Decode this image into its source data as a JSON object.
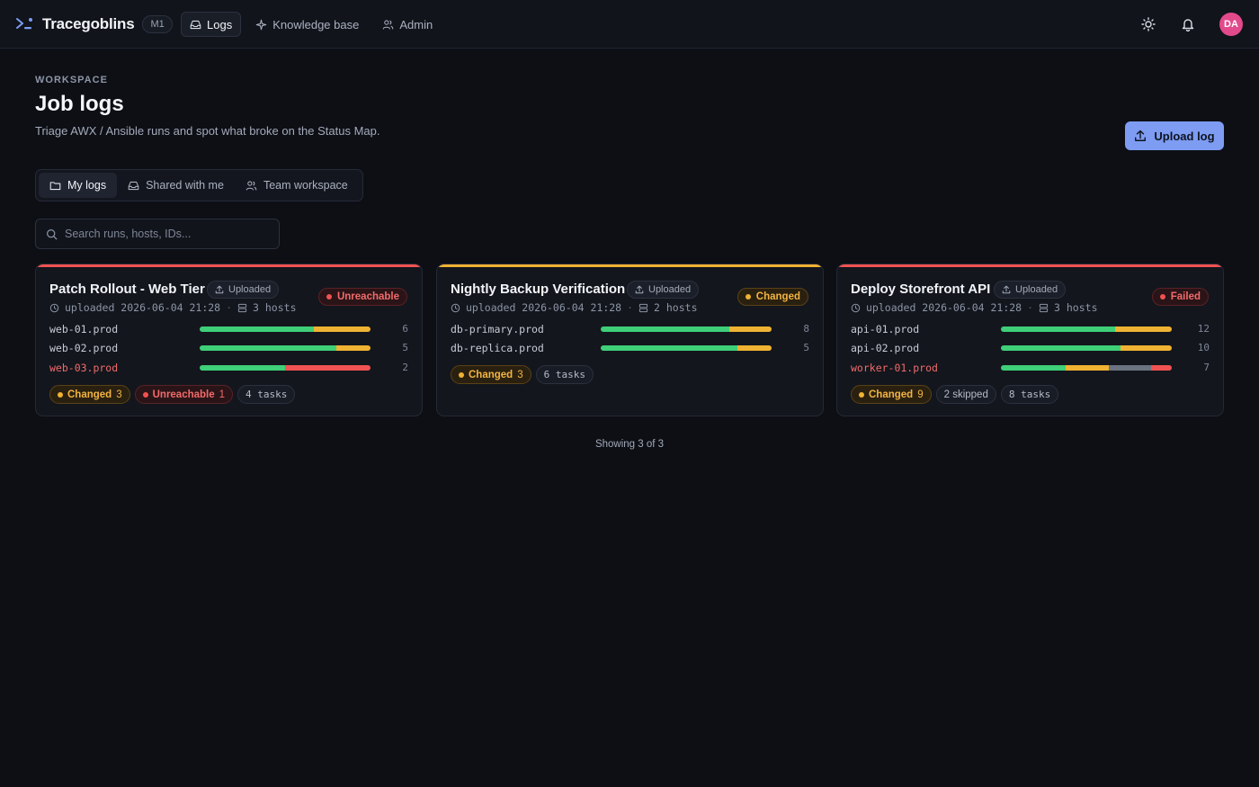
{
  "app": {
    "name": "Tracegoblins",
    "badge": "M1"
  },
  "nav": [
    {
      "label": "Logs",
      "icon": "inbox-icon",
      "active": true
    },
    {
      "label": "Knowledge base",
      "icon": "sparkle-icon",
      "active": false
    },
    {
      "label": "Admin",
      "icon": "users-icon",
      "active": false
    }
  ],
  "user": {
    "initials": "DA"
  },
  "header": {
    "eyebrow": "WORKSPACE",
    "title": "Job logs",
    "subtitle": "Triage AWX / Ansible runs and spot what broke on the Status Map.",
    "upload_label": "Upload log"
  },
  "tabs": [
    {
      "label": "My logs",
      "icon": "folder-icon",
      "active": true
    },
    {
      "label": "Shared with me",
      "icon": "inbox-icon",
      "active": false
    },
    {
      "label": "Team workspace",
      "icon": "users-icon",
      "active": false
    }
  ],
  "search": {
    "placeholder": "Search runs, hosts, IDs..."
  },
  "colors": {
    "ok": "#3ecf78",
    "changed": "#f0b232",
    "unreachable": "#f05252",
    "skipped": "#6b7280",
    "failed": "#f05252",
    "accent": "#7d9cf2"
  },
  "cards": [
    {
      "title": "Patch Rollout - Web Tier",
      "uploaded_chip": "Uploaded",
      "status": "Unreachable",
      "meta_uploaded": "uploaded 2026-06-04 21:28",
      "meta_hosts": "3 hosts",
      "hosts": [
        {
          "name": "web-01.prod",
          "count": "6",
          "bad": false,
          "segments": [
            {
              "type": "ok",
              "frac": 0.67
            },
            {
              "type": "changed",
              "frac": 0.33
            }
          ]
        },
        {
          "name": "web-02.prod",
          "count": "5",
          "bad": false,
          "segments": [
            {
              "type": "ok",
              "frac": 0.8
            },
            {
              "type": "changed",
              "frac": 0.2
            }
          ]
        },
        {
          "name": "web-03.prod",
          "count": "2",
          "bad": true,
          "segments": [
            {
              "type": "ok",
              "frac": 0.5
            },
            {
              "type": "unreach",
              "frac": 0.5
            }
          ]
        }
      ],
      "changed_label": "Changed",
      "changed_count": "3",
      "unreach_label": "Unreachable",
      "unreach_count": "1",
      "tasks": "4 tasks"
    },
    {
      "title": "Nightly Backup Verification",
      "uploaded_chip": "Uploaded",
      "status": "Changed",
      "meta_uploaded": "uploaded 2026-06-04 21:28",
      "meta_hosts": "2 hosts",
      "hosts": [
        {
          "name": "db-primary.prod",
          "count": "8",
          "bad": false,
          "segments": [
            {
              "type": "ok",
              "frac": 0.75
            },
            {
              "type": "changed",
              "frac": 0.25
            }
          ]
        },
        {
          "name": "db-replica.prod",
          "count": "5",
          "bad": false,
          "segments": [
            {
              "type": "ok",
              "frac": 0.8
            },
            {
              "type": "changed",
              "frac": 0.2
            }
          ]
        }
      ],
      "changed_label": "Changed",
      "changed_count": "3",
      "tasks": "6 tasks"
    },
    {
      "title": "Deploy Storefront API",
      "uploaded_chip": "Uploaded",
      "status": "Failed",
      "meta_uploaded": "uploaded 2026-06-04 21:28",
      "meta_hosts": "3 hosts",
      "hosts": [
        {
          "name": "api-01.prod",
          "count": "12",
          "bad": false,
          "segments": [
            {
              "type": "ok",
              "frac": 0.67
            },
            {
              "type": "changed",
              "frac": 0.33
            }
          ]
        },
        {
          "name": "api-02.prod",
          "count": "10",
          "bad": false,
          "segments": [
            {
              "type": "ok",
              "frac": 0.7
            },
            {
              "type": "changed",
              "frac": 0.3
            }
          ]
        },
        {
          "name": "worker-01.prod",
          "count": "7",
          "bad": true,
          "segments": [
            {
              "type": "ok",
              "frac": 0.38
            },
            {
              "type": "changed",
              "frac": 0.25
            },
            {
              "type": "skipped",
              "frac": 0.25
            },
            {
              "type": "failed",
              "frac": 0.12
            }
          ]
        }
      ],
      "changed_label": "Changed",
      "changed_count": "9",
      "skipped": "2 skipped",
      "tasks": "8 tasks"
    }
  ],
  "footer": {
    "showing": "Showing 3 of 3"
  }
}
